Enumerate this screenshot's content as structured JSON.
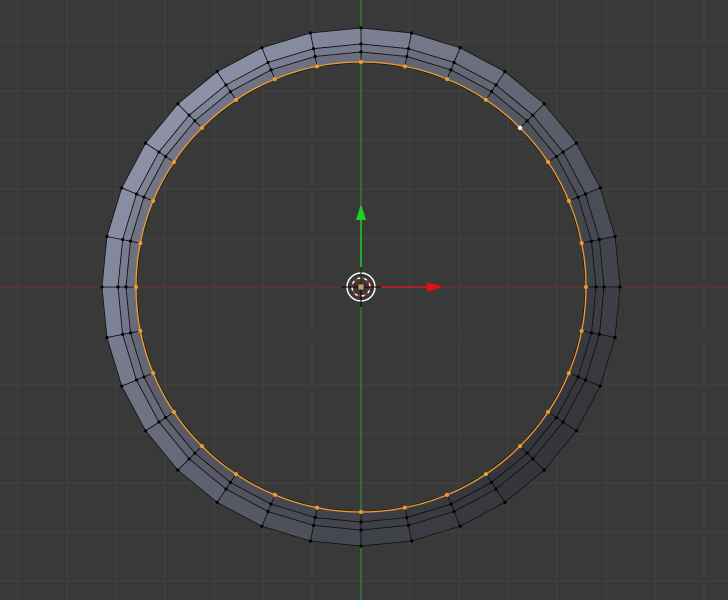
{
  "viewport": {
    "background_color": "#393939",
    "grid_color": "#434343",
    "x_axis_color": "#8b2a2a",
    "y_axis_color": "#2fa12f"
  },
  "mesh": {
    "object": "ring",
    "segments": 32,
    "selected_edge_color": "#f39c2a",
    "edge_color": "#000000",
    "face_light": "#8c91a8",
    "face_dark": "#35363b"
  },
  "gizmo": {
    "x_arrow_color": "#e01010",
    "y_arrow_color": "#20d020"
  }
}
